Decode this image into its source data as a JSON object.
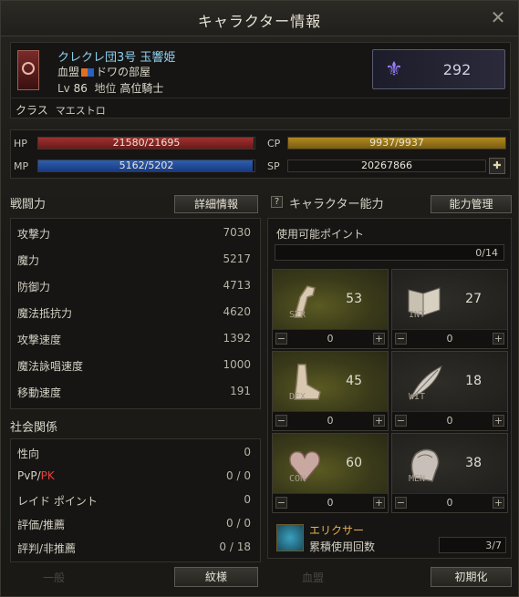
{
  "window": {
    "title": "キャラクター情報",
    "close_glyph": "✕"
  },
  "character": {
    "name": "クレクレ団3号 玉響姫",
    "clan_label": "血盟",
    "clan_name": "ドワの部屋",
    "level_label": "Lv",
    "level": "86",
    "rank_label": "地位",
    "rank": "高位騎士",
    "class_label": "クラス",
    "class_name": "マエストロ",
    "fame": "292",
    "fame_icon": "emblem-icon"
  },
  "vitals": {
    "hp": {
      "label": "HP",
      "text": "21580/21695",
      "ratio": 0.9947
    },
    "mp": {
      "label": "MP",
      "text": "5162/5202",
      "ratio": 0.9923
    },
    "cp": {
      "label": "CP",
      "text": "9937/9937",
      "ratio": 1.0
    },
    "sp": {
      "label": "SP",
      "text": "20267866"
    }
  },
  "combat": {
    "title": "戦闘力",
    "detail_button": "詳細情報",
    "rows": [
      {
        "label": "攻撃力",
        "value": "7030"
      },
      {
        "label": "魔力",
        "value": "5217"
      },
      {
        "label": "防御力",
        "value": "4713"
      },
      {
        "label": "魔法抵抗力",
        "value": "4620"
      },
      {
        "label": "攻撃速度",
        "value": "1392"
      },
      {
        "label": "魔法詠唱速度",
        "value": "1000"
      },
      {
        "label": "移動速度",
        "value": "191"
      }
    ]
  },
  "social": {
    "title": "社会関係",
    "rows": [
      {
        "label": "性向",
        "value": "0"
      },
      {
        "label_a": "PvP/",
        "label_b": "PK",
        "value": "0 / 0"
      },
      {
        "label": "レイド ポイント",
        "value": "0"
      },
      {
        "label": "評価/推薦",
        "value": "0 / 0"
      },
      {
        "label": "評判/非推薦",
        "value": "0 / 18"
      }
    ]
  },
  "ability": {
    "title": "キャラクター能力",
    "help_glyph": "?",
    "manage_button": "能力管理",
    "points_label": "使用可能ポイント",
    "points_value": "0/14",
    "stats": [
      {
        "name": "STR",
        "value": "53",
        "alloc": "0"
      },
      {
        "name": "INT",
        "value": "27",
        "alloc": "0"
      },
      {
        "name": "DEX",
        "value": "45",
        "alloc": "0"
      },
      {
        "name": "WIT",
        "value": "18",
        "alloc": "0"
      },
      {
        "name": "CON",
        "value": "60",
        "alloc": "0"
      },
      {
        "name": "MEN",
        "value": "38",
        "alloc": "0"
      }
    ],
    "elixir_name": "エリクサー",
    "elixir_label": "累積使用回数",
    "elixir_value": "3/7"
  },
  "footer": {
    "faded_left": "一般",
    "faded_mid": "血盟",
    "crest_button": "紋様",
    "reset_button": "初期化"
  },
  "colors": {
    "hp": "#a03030",
    "mp": "#2c5fb0",
    "cp": "#b08a20",
    "name": "#8fd0ee",
    "pk": "#e04040"
  }
}
